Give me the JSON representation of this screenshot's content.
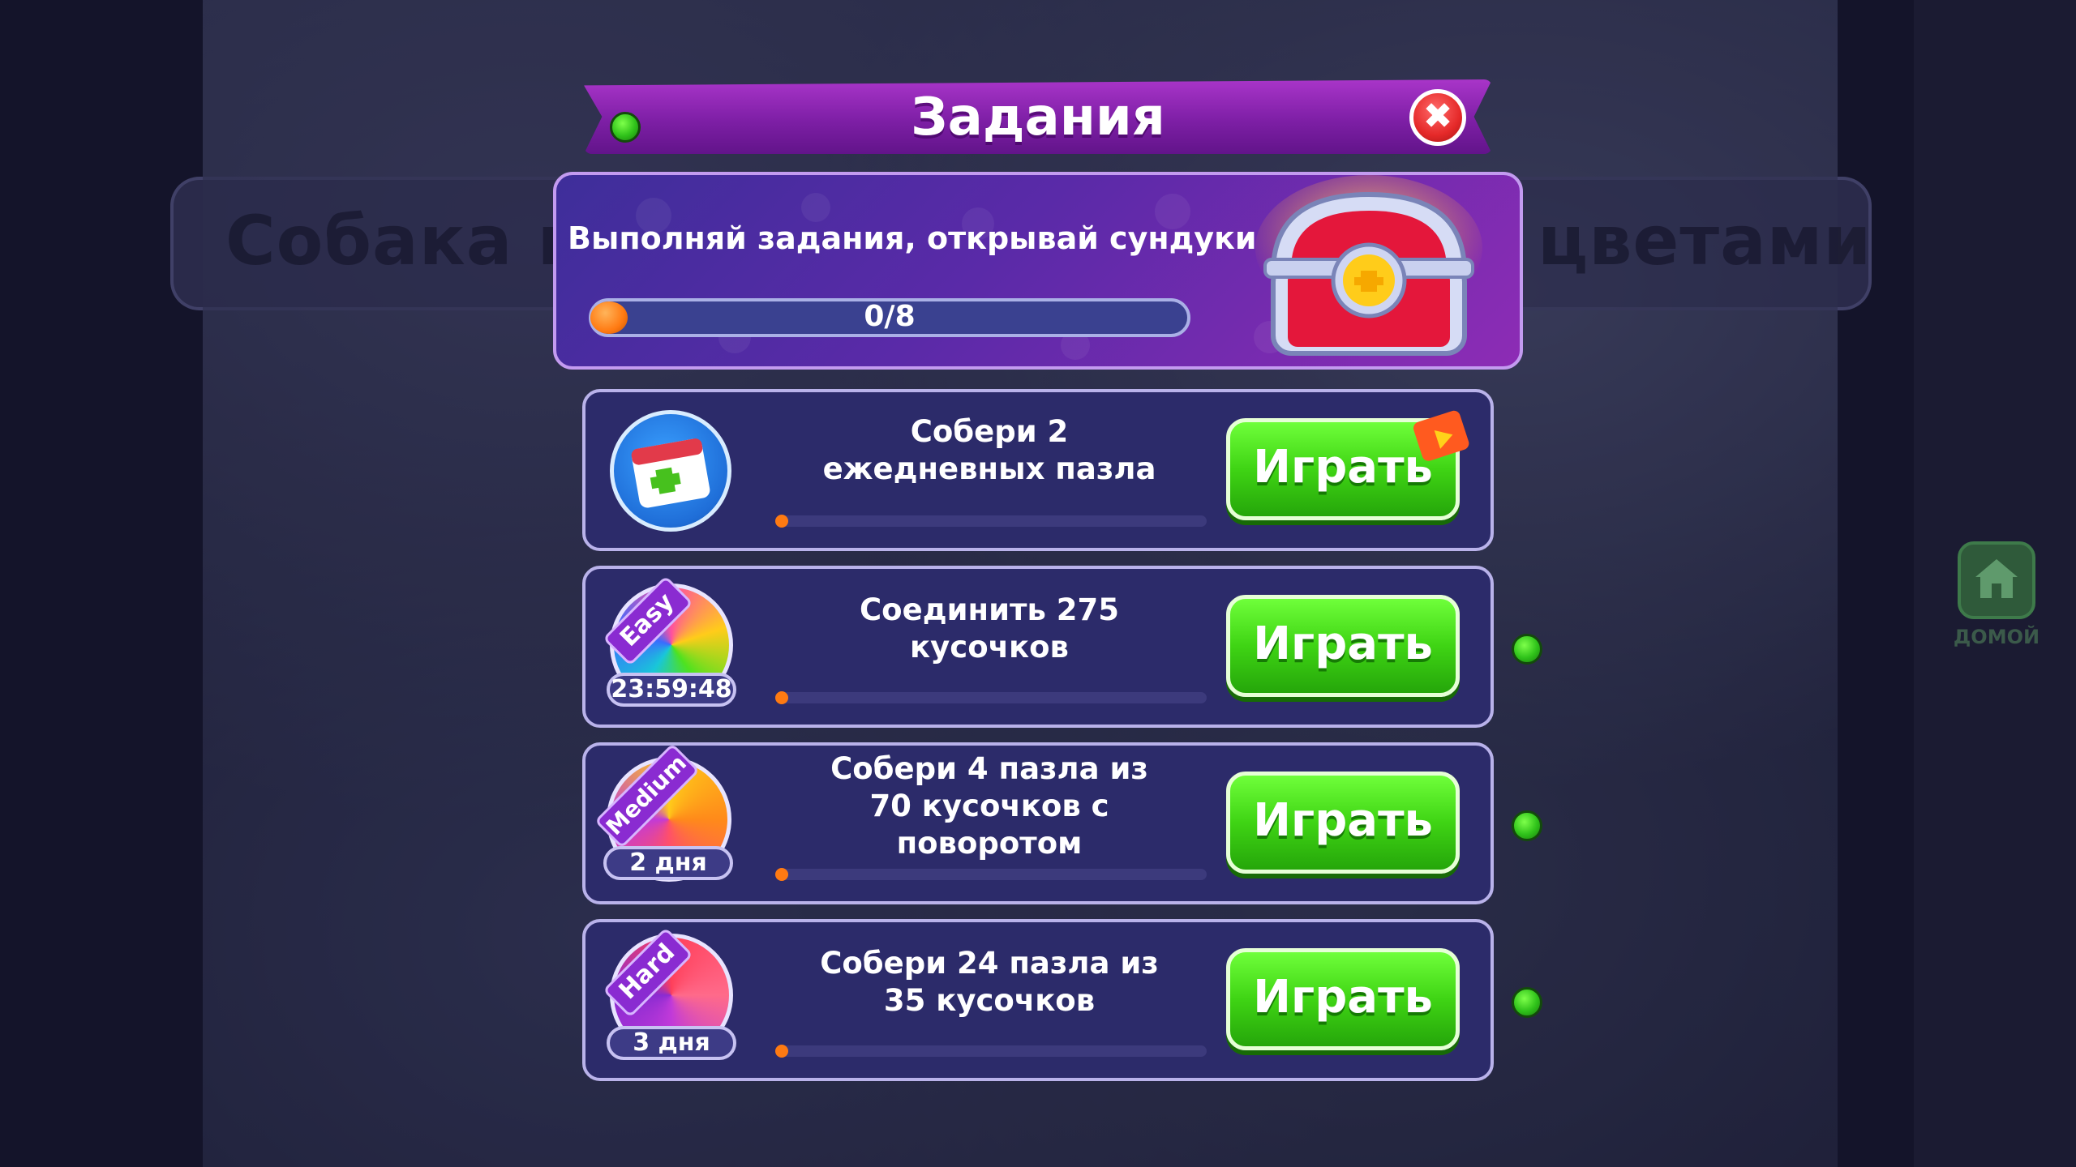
{
  "background": {
    "title_left": "Собака в",
    "title_right": "цветами",
    "home_label": "ДОМОЙ"
  },
  "header": {
    "title": "Задания",
    "close_symbol": "✖"
  },
  "promo": {
    "text": "Выполняй задания, открывай сундуки",
    "progress_label": "0/8",
    "progress_value": 0,
    "progress_max": 8
  },
  "quests": [
    {
      "title_line1": "Собери 2",
      "title_line2": "ежедневных пазла",
      "title_line3": "",
      "button": "Играть",
      "icon": "daily-calendar-icon",
      "badge": "",
      "difficulty": ""
    },
    {
      "title_line1": "Соединить 275",
      "title_line2": "кусочков",
      "title_line3": "",
      "button": "Играть",
      "icon": "puzzle-easy-icon",
      "badge": "23:59:48",
      "difficulty": "Easy"
    },
    {
      "title_line1": "Собери 4 пазла из",
      "title_line2": "70 кусочков с",
      "title_line3": "поворотом",
      "button": "Играть",
      "icon": "puzzle-medium-icon",
      "badge": "2 дня",
      "difficulty": "Medium"
    },
    {
      "title_line1": "Собери 24 пазла из",
      "title_line2": "35 кусочков",
      "title_line3": "",
      "button": "Играть",
      "icon": "puzzle-hard-icon",
      "badge": "3 дня",
      "difficulty": "Hard"
    }
  ],
  "colors": {
    "accent_purple": "#8d2cb5",
    "play_green": "#3fd414",
    "row_bg": "#2c2b6a",
    "progress_orange": "#ff7a12"
  }
}
